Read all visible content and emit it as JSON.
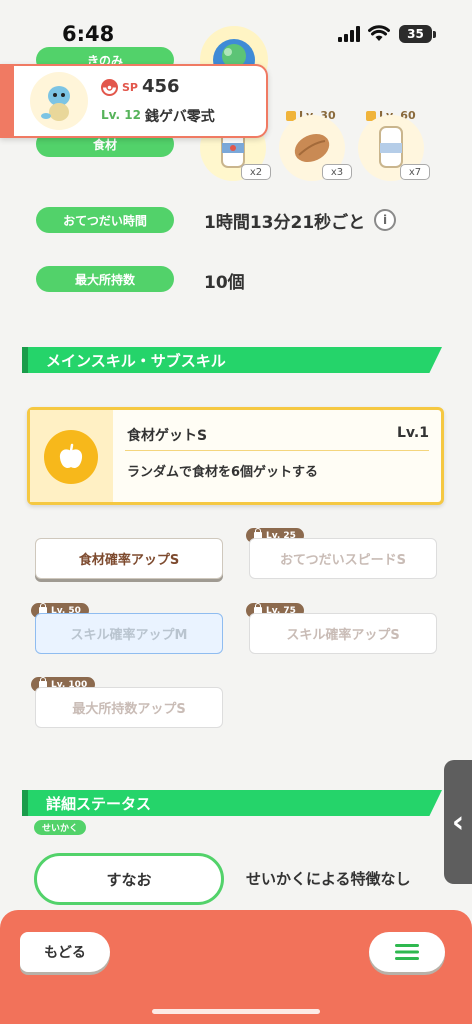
{
  "status_bar": {
    "time": "6:48",
    "battery": "35"
  },
  "header": {
    "sp_label": "SP",
    "sp_value": "456",
    "level": "Lv. 12",
    "name": "銭ゲバ零式"
  },
  "top_labels": {
    "berry": "きのみ",
    "ingredients": "食材"
  },
  "ingredients": [
    {
      "lock_label": "",
      "count": "x2",
      "icon": "milk-bottle-icon"
    },
    {
      "lock_label": "Lv. 30",
      "count": "x3",
      "icon": "cacao-icon"
    },
    {
      "lock_label": "Lv. 60",
      "count": "x7",
      "icon": "milk-bottle-icon"
    }
  ],
  "help_time": {
    "label": "おてつだい時間",
    "value": "1時間13分21秒ごと"
  },
  "max_carry": {
    "label": "最大所持数",
    "value": "10個"
  },
  "skills_section": {
    "title": "メインスキル・サブスキル"
  },
  "main_skill": {
    "name": "食材ゲットS",
    "level": "Lv.1",
    "description": "ランダムで食材を6個ゲットする",
    "icon": "apple-icon"
  },
  "sub_skills": [
    {
      "label": "食材確率アップS",
      "lock": ""
    },
    {
      "label": "おてつだいスピードS",
      "lock": "Lv. 25"
    },
    {
      "label": "スキル確率アップM",
      "lock": "Lv. 50"
    },
    {
      "label": "スキル確率アップS",
      "lock": "Lv. 75"
    },
    {
      "label": "最大所持数アップS",
      "lock": "Lv. 100"
    }
  ],
  "details_section": {
    "title": "詳細ステータス"
  },
  "nature": {
    "tag": "せいかく",
    "value": "すなお",
    "description": "せいかくによる特徴なし"
  },
  "bottom": {
    "back_label": "もどる"
  },
  "colors": {
    "accent_green": "#52d26a",
    "section_green": "#25d46a",
    "bottom_bar": "#f2725a",
    "skill_gold": "#f5c842"
  }
}
